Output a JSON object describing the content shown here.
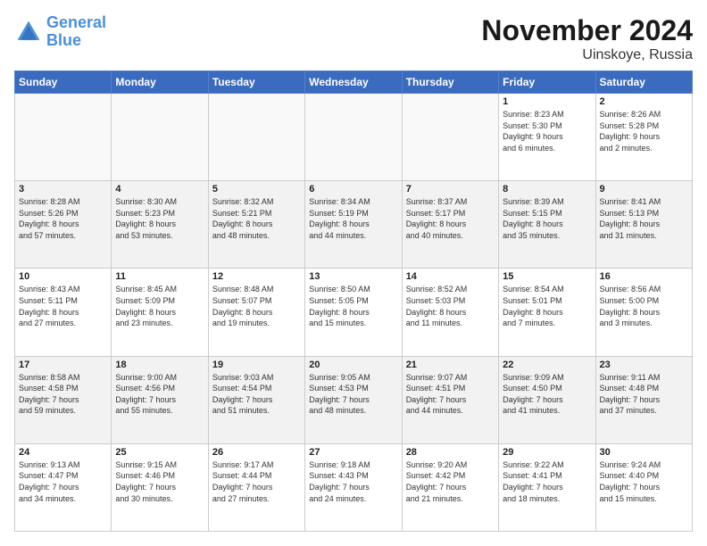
{
  "header": {
    "logo_line1": "General",
    "logo_line2": "Blue",
    "month": "November 2024",
    "location": "Uinskoye, Russia"
  },
  "days_of_week": [
    "Sunday",
    "Monday",
    "Tuesday",
    "Wednesday",
    "Thursday",
    "Friday",
    "Saturday"
  ],
  "weeks": [
    [
      {
        "num": "",
        "info": ""
      },
      {
        "num": "",
        "info": ""
      },
      {
        "num": "",
        "info": ""
      },
      {
        "num": "",
        "info": ""
      },
      {
        "num": "",
        "info": ""
      },
      {
        "num": "1",
        "info": "Sunrise: 8:23 AM\nSunset: 5:30 PM\nDaylight: 9 hours\nand 6 minutes."
      },
      {
        "num": "2",
        "info": "Sunrise: 8:26 AM\nSunset: 5:28 PM\nDaylight: 9 hours\nand 2 minutes."
      }
    ],
    [
      {
        "num": "3",
        "info": "Sunrise: 8:28 AM\nSunset: 5:26 PM\nDaylight: 8 hours\nand 57 minutes."
      },
      {
        "num": "4",
        "info": "Sunrise: 8:30 AM\nSunset: 5:23 PM\nDaylight: 8 hours\nand 53 minutes."
      },
      {
        "num": "5",
        "info": "Sunrise: 8:32 AM\nSunset: 5:21 PM\nDaylight: 8 hours\nand 48 minutes."
      },
      {
        "num": "6",
        "info": "Sunrise: 8:34 AM\nSunset: 5:19 PM\nDaylight: 8 hours\nand 44 minutes."
      },
      {
        "num": "7",
        "info": "Sunrise: 8:37 AM\nSunset: 5:17 PM\nDaylight: 8 hours\nand 40 minutes."
      },
      {
        "num": "8",
        "info": "Sunrise: 8:39 AM\nSunset: 5:15 PM\nDaylight: 8 hours\nand 35 minutes."
      },
      {
        "num": "9",
        "info": "Sunrise: 8:41 AM\nSunset: 5:13 PM\nDaylight: 8 hours\nand 31 minutes."
      }
    ],
    [
      {
        "num": "10",
        "info": "Sunrise: 8:43 AM\nSunset: 5:11 PM\nDaylight: 8 hours\nand 27 minutes."
      },
      {
        "num": "11",
        "info": "Sunrise: 8:45 AM\nSunset: 5:09 PM\nDaylight: 8 hours\nand 23 minutes."
      },
      {
        "num": "12",
        "info": "Sunrise: 8:48 AM\nSunset: 5:07 PM\nDaylight: 8 hours\nand 19 minutes."
      },
      {
        "num": "13",
        "info": "Sunrise: 8:50 AM\nSunset: 5:05 PM\nDaylight: 8 hours\nand 15 minutes."
      },
      {
        "num": "14",
        "info": "Sunrise: 8:52 AM\nSunset: 5:03 PM\nDaylight: 8 hours\nand 11 minutes."
      },
      {
        "num": "15",
        "info": "Sunrise: 8:54 AM\nSunset: 5:01 PM\nDaylight: 8 hours\nand 7 minutes."
      },
      {
        "num": "16",
        "info": "Sunrise: 8:56 AM\nSunset: 5:00 PM\nDaylight: 8 hours\nand 3 minutes."
      }
    ],
    [
      {
        "num": "17",
        "info": "Sunrise: 8:58 AM\nSunset: 4:58 PM\nDaylight: 7 hours\nand 59 minutes."
      },
      {
        "num": "18",
        "info": "Sunrise: 9:00 AM\nSunset: 4:56 PM\nDaylight: 7 hours\nand 55 minutes."
      },
      {
        "num": "19",
        "info": "Sunrise: 9:03 AM\nSunset: 4:54 PM\nDaylight: 7 hours\nand 51 minutes."
      },
      {
        "num": "20",
        "info": "Sunrise: 9:05 AM\nSunset: 4:53 PM\nDaylight: 7 hours\nand 48 minutes."
      },
      {
        "num": "21",
        "info": "Sunrise: 9:07 AM\nSunset: 4:51 PM\nDaylight: 7 hours\nand 44 minutes."
      },
      {
        "num": "22",
        "info": "Sunrise: 9:09 AM\nSunset: 4:50 PM\nDaylight: 7 hours\nand 41 minutes."
      },
      {
        "num": "23",
        "info": "Sunrise: 9:11 AM\nSunset: 4:48 PM\nDaylight: 7 hours\nand 37 minutes."
      }
    ],
    [
      {
        "num": "24",
        "info": "Sunrise: 9:13 AM\nSunset: 4:47 PM\nDaylight: 7 hours\nand 34 minutes."
      },
      {
        "num": "25",
        "info": "Sunrise: 9:15 AM\nSunset: 4:46 PM\nDaylight: 7 hours\nand 30 minutes."
      },
      {
        "num": "26",
        "info": "Sunrise: 9:17 AM\nSunset: 4:44 PM\nDaylight: 7 hours\nand 27 minutes."
      },
      {
        "num": "27",
        "info": "Sunrise: 9:18 AM\nSunset: 4:43 PM\nDaylight: 7 hours\nand 24 minutes."
      },
      {
        "num": "28",
        "info": "Sunrise: 9:20 AM\nSunset: 4:42 PM\nDaylight: 7 hours\nand 21 minutes."
      },
      {
        "num": "29",
        "info": "Sunrise: 9:22 AM\nSunset: 4:41 PM\nDaylight: 7 hours\nand 18 minutes."
      },
      {
        "num": "30",
        "info": "Sunrise: 9:24 AM\nSunset: 4:40 PM\nDaylight: 7 hours\nand 15 minutes."
      }
    ]
  ]
}
